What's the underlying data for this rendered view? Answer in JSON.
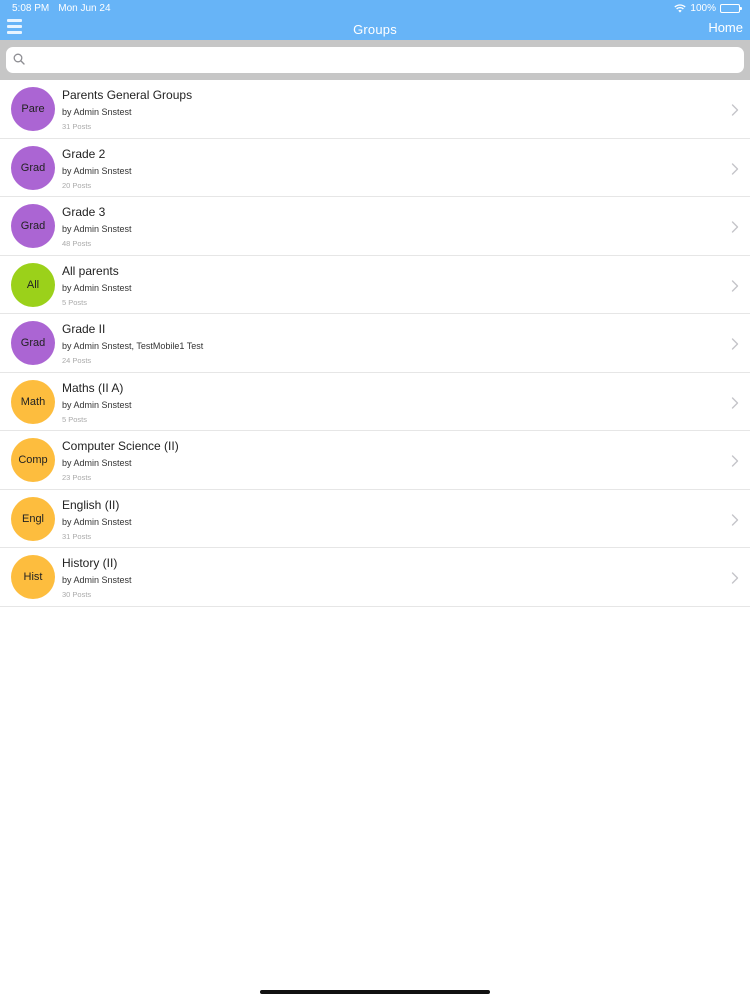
{
  "status_bar": {
    "time": "5:08 PM",
    "date": "Mon Jun 24",
    "battery": "100%"
  },
  "nav": {
    "title": "Groups",
    "home_label": "Home",
    "menu_icon": "hamburger-menu-icon"
  },
  "search": {
    "placeholder": "",
    "value": "",
    "icon": "search-icon"
  },
  "groups": [
    {
      "initials": "Pare",
      "name": "Parents General Groups",
      "by": "by Admin Snstest",
      "posts": "31 Posts",
      "color": "#ab65d3"
    },
    {
      "initials": "Grad",
      "name": "Grade 2",
      "by": "by Admin Snstest",
      "posts": "20 Posts",
      "color": "#ab65d3"
    },
    {
      "initials": "Grad",
      "name": "Grade 3",
      "by": "by Admin Snstest",
      "posts": "48 Posts",
      "color": "#ab65d3"
    },
    {
      "initials": "All",
      "name": "All parents",
      "by": "by Admin Snstest",
      "posts": "5 Posts",
      "color": "#9bd11a"
    },
    {
      "initials": "Grad",
      "name": "Grade II",
      "by": "by Admin Snstest, TestMobile1 Test",
      "posts": "24 Posts",
      "color": "#ab65d3"
    },
    {
      "initials": "Math",
      "name": "Maths (II A)",
      "by": "by Admin Snstest",
      "posts": "5 Posts",
      "color": "#fdbd3e"
    },
    {
      "initials": "Comp",
      "name": "Computer Science (II)",
      "by": "by Admin Snstest",
      "posts": "23 Posts",
      "color": "#fdbd3e"
    },
    {
      "initials": "Engl",
      "name": "English (II)",
      "by": "by Admin Snstest",
      "posts": "31 Posts",
      "color": "#fdbd3e"
    },
    {
      "initials": "Hist",
      "name": "History (II)",
      "by": "by Admin Snstest",
      "posts": "30 Posts",
      "color": "#fdbd3e"
    }
  ],
  "colors": {
    "nav_bar": "#67b4f7",
    "search_bg": "#c6c6c6"
  }
}
